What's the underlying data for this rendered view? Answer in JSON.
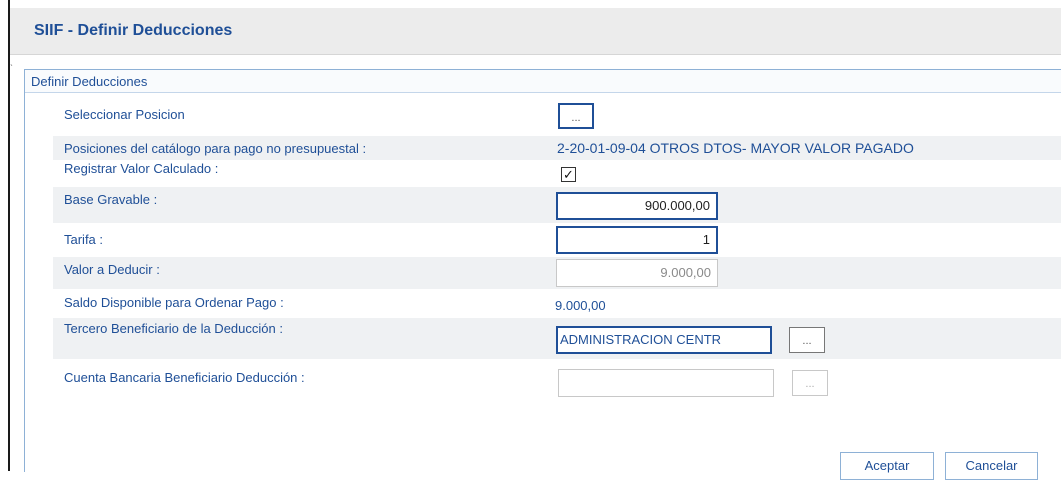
{
  "window": {
    "title": "SIIF - Definir Deducciones"
  },
  "panel": {
    "header": "Definir Deducciones"
  },
  "fields": {
    "seleccionar_posicion": {
      "label": "Seleccionar Posicion",
      "button": "..."
    },
    "posiciones_catalogo": {
      "label": "Posiciones del catálogo para pago no presupuestal :",
      "value": "2-20-01-09-04 OTROS DTOS- MAYOR VALOR PAGADO"
    },
    "registrar_valor": {
      "label": "Registrar Valor Calculado :",
      "checked": "☑",
      "checkmark": "✓"
    },
    "base_gravable": {
      "label": "Base Gravable :",
      "value": "900.000,00"
    },
    "tarifa": {
      "label": "Tarifa :",
      "value": "1"
    },
    "valor_deducir": {
      "label": "Valor a Deducir :",
      "value": "9.000,00"
    },
    "saldo_disponible": {
      "label": "Saldo Disponible para Ordenar Pago :",
      "value": "9.000,00"
    },
    "tercero_beneficiario": {
      "label": "Tercero Beneficiario de la Deducción :",
      "value": "ADMINISTRACION CENTR",
      "button": "..."
    },
    "cuenta_bancaria": {
      "label": "Cuenta Bancaria Beneficiario Deducción :",
      "value": "",
      "button": "..."
    }
  },
  "actions": {
    "accept": "Aceptar",
    "cancel": "Cancelar"
  },
  "colors": {
    "label_blue": "#1f4f97",
    "row_gray": "#eff1f3",
    "panel_border": "#8eb1d6"
  }
}
